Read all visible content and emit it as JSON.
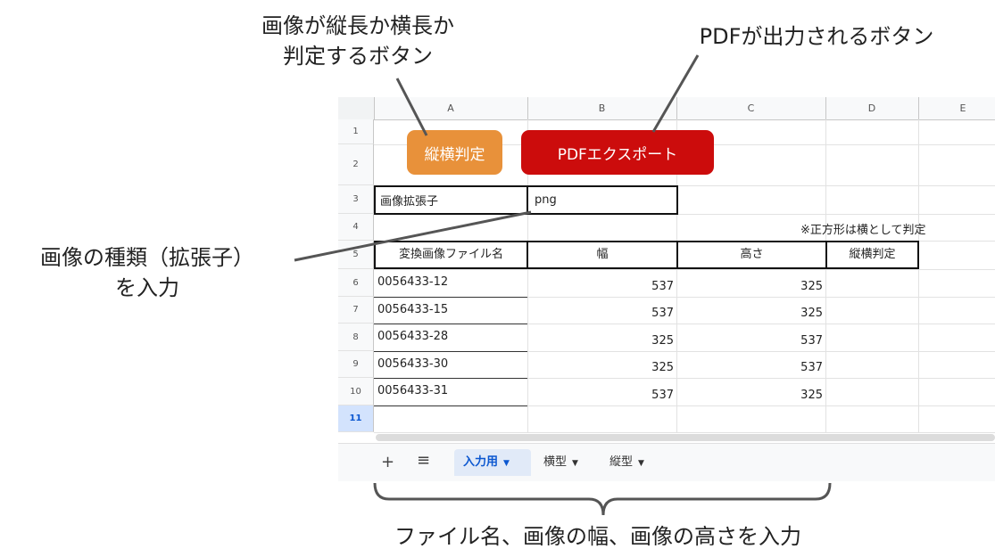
{
  "annotations": {
    "orientation_line1": "画像が縦長か横長か",
    "orientation_line2": "判定するボタン",
    "pdf_button": "PDFが出力されるボタン",
    "extension_line1": "画像の種類（拡張子）",
    "extension_line2": "を入力",
    "bottom": "ファイル名、画像の幅、画像の高さを入力"
  },
  "sheet": {
    "columns": [
      "A",
      "B",
      "C",
      "D",
      "E"
    ],
    "rows": [
      "1",
      "2",
      "3",
      "4",
      "5",
      "6",
      "7",
      "8",
      "9",
      "10",
      "11"
    ],
    "buttons": {
      "orientation": "縦横判定",
      "pdf_export": "PDFエクスポート"
    },
    "extension_label": "画像拡張子",
    "extension_value": "png",
    "note": "※正方形は横として判定",
    "table_headers": [
      "変換画像ファイル名",
      "幅",
      "高さ",
      "縦横判定"
    ],
    "table_rows": [
      {
        "name": "0056433-12",
        "width": "537",
        "height": "325",
        "orient": ""
      },
      {
        "name": "0056433-15",
        "width": "537",
        "height": "325",
        "orient": ""
      },
      {
        "name": "0056433-28",
        "width": "325",
        "height": "537",
        "orient": ""
      },
      {
        "name": "0056433-30",
        "width": "325",
        "height": "537",
        "orient": ""
      },
      {
        "name": "0056433-31",
        "width": "537",
        "height": "325",
        "orient": ""
      }
    ],
    "tabs": [
      {
        "label": "入力用",
        "active": true
      },
      {
        "label": "横型",
        "active": false
      },
      {
        "label": "縦型",
        "active": false
      }
    ],
    "colors": {
      "orientation_button": "#e8913a",
      "pdf_button": "#cc0c0c",
      "active_tab": "#0b57d0"
    }
  }
}
